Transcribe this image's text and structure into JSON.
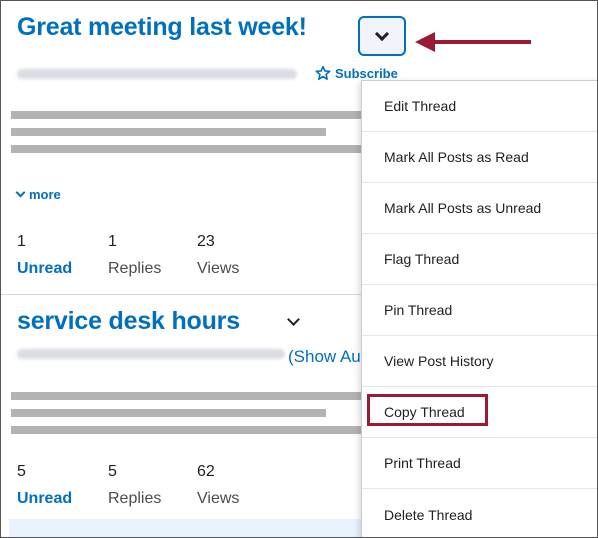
{
  "threads": [
    {
      "title": "Great meeting last week!",
      "subscribe_label": "Subscribe",
      "more_label": "more",
      "stats": [
        {
          "value": "1",
          "label": "Unread"
        },
        {
          "value": "1",
          "label": "Replies"
        },
        {
          "value": "23",
          "label": "Views"
        }
      ]
    },
    {
      "title": "service desk hours",
      "show_author_label": "(Show Au",
      "stats": [
        {
          "value": "5",
          "label": "Unread"
        },
        {
          "value": "5",
          "label": "Replies"
        },
        {
          "value": "62",
          "label": "Views"
        }
      ]
    }
  ],
  "context_menu": {
    "items": [
      "Edit Thread",
      "Mark All Posts as Read",
      "Mark All Posts as Unread",
      "Flag Thread",
      "Pin Thread",
      "View Post History",
      "Copy Thread",
      "Print Thread",
      "Delete Thread"
    ],
    "highlighted_item": "Copy Thread"
  },
  "icons": {
    "context_button": "chevron-down-icon",
    "subscribe": "star-outline-icon",
    "annotation": "arrow-left-icon"
  },
  "colors": {
    "link": "#006fbf",
    "annotation": "#9b1b34",
    "placeholder_bars": "#b3b3b3"
  }
}
